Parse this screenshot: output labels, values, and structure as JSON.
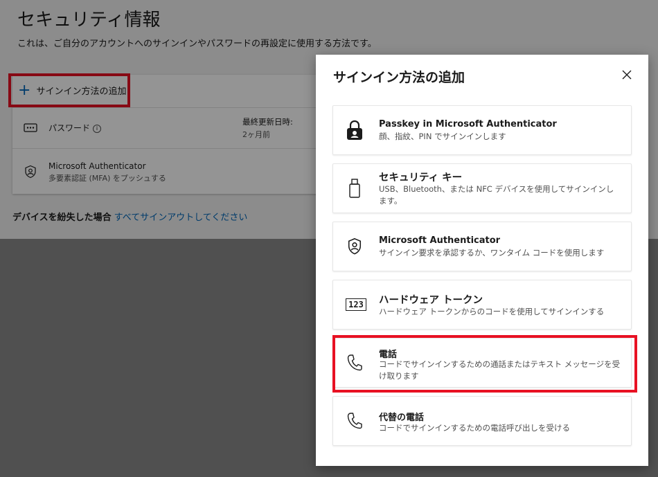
{
  "page": {
    "title": "セキュリティ情報",
    "description": "これは、ご自分のアカウントへのサインインやパスワードの再設定に使用する方法です。",
    "add_method_label": "サインイン方法の追加",
    "methods": [
      {
        "name": "パスワード",
        "sub": "",
        "meta_label": "最終更新日時:",
        "meta_value": "2ヶ月前",
        "icon": "password-dots-icon"
      },
      {
        "name": "Microsoft Authenticator",
        "sub": "多要素認証 (MFA) をプッシュする",
        "icon": "authenticator-icon"
      }
    ],
    "lost_device_label": "デバイスを紛失した場合",
    "lost_device_link": "すべてサインアウトしてください"
  },
  "dialog": {
    "title": "サインイン方法の追加",
    "options": [
      {
        "title": "Passkey in Microsoft Authenticator",
        "desc": "顔、指紋、PIN でサインインします",
        "icon": "passkey-lock-icon"
      },
      {
        "title": "セキュリティ キー",
        "desc": "USB、Bluetooth、または NFC デバイスを使用してサインインします。",
        "icon": "usb-key-icon"
      },
      {
        "title": "Microsoft Authenticator",
        "desc": "サインイン要求を承認するか、ワンタイム コードを使用します",
        "icon": "authenticator-icon"
      },
      {
        "title": "ハードウェア トークン",
        "desc": "ハードウェア トークンからのコードを使用してサインインする",
        "icon": "token-123-icon",
        "icon_text": "123"
      },
      {
        "title": "電話",
        "desc": "コードでサインインするための通話またはテキスト メッセージを受け取ります",
        "icon": "phone-icon"
      },
      {
        "title": "代替の電話",
        "desc": "コードでサインインするための電話呼び出しを受ける",
        "icon": "phone-icon"
      }
    ]
  },
  "colors": {
    "accent": "#0067b8",
    "highlight": "#e81123"
  }
}
